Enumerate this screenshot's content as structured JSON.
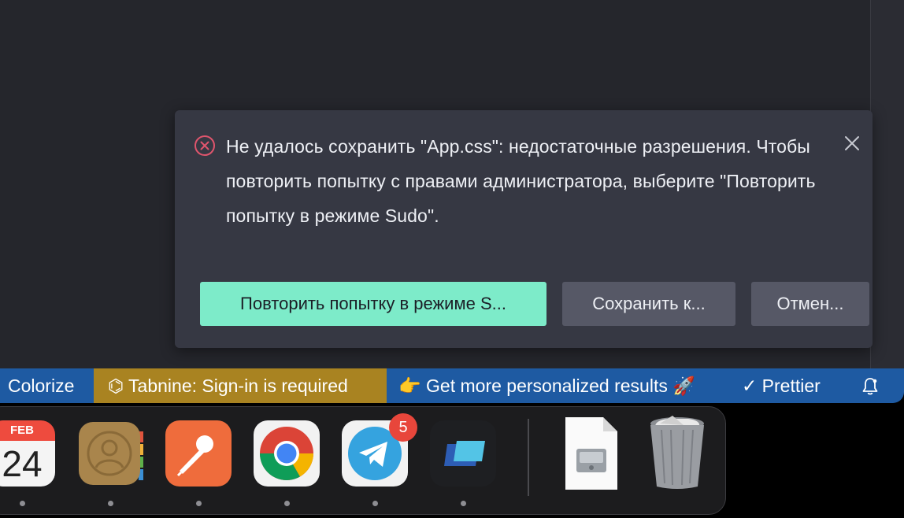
{
  "notification": {
    "message": "Не удалось сохранить \"App.css\": недостаточные разрешения. Чтобы повторить попытку с правами администратора, выберите \"Повторить попытку в режиме Sudo\".",
    "primary_button": "Повторить попытку в режиме S...",
    "save_button": "Сохранить к...",
    "cancel_button": "Отмен...",
    "icon": "error-circle-icon",
    "close_icon": "close-icon"
  },
  "statusbar": {
    "colorize": "Colorize",
    "tabnine": "⌬ Tabnine: Sign-in is required",
    "personalized": "👉 Get more personalized results 🚀",
    "prettier": "✓ Prettier",
    "bell_icon": "bell-icon"
  },
  "dock": {
    "calendar_month": "FEB",
    "calendar_day": "24",
    "telegram_badge": "5",
    "apps": [
      "calendar",
      "contacts",
      "postman",
      "chrome",
      "telegram",
      "app-blue",
      "disk-image-file",
      "trash"
    ]
  },
  "colors": {
    "editor_bg": "#25262c",
    "notification_bg": "#363843",
    "primary": "#7debc9",
    "statusbar": "#1e5aa2",
    "tabnine": "#a98321",
    "error": "#e0556d"
  }
}
